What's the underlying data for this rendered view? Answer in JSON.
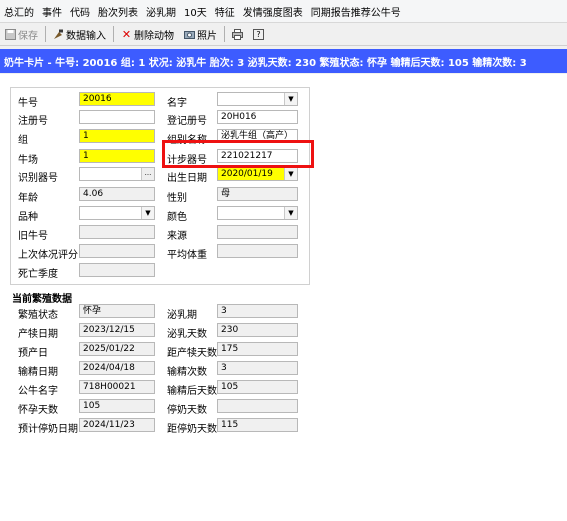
{
  "menu": [
    "总汇的",
    "事件",
    "代码",
    "胎次列表",
    "泌乳期",
    "10天",
    "特征",
    "发情强度图表",
    "同期报告推荐公牛号"
  ],
  "toolbar": {
    "save": "保存",
    "data_input": "数据输入",
    "delete_animal": "删除动物",
    "photo": "照片"
  },
  "title": "奶牛卡片 - 牛号: 20016  组: 1  状况: 泌乳牛  胎次: 3  泌乳天数: 230  繁殖状态: 怀孕  输精后天数: 105  输精次数: 3",
  "basic": {
    "cow_no_label": "牛号",
    "cow_no": "20016",
    "name_label": "名字",
    "name": "",
    "reg_no_label": "注册号",
    "reg_no": "",
    "herdbook_label": "登记册号",
    "herdbook": "20H016",
    "group_label": "组",
    "group": "1",
    "group_name_label": "组别名称",
    "group_name": "泌乳牛组（高产）",
    "farm_label": "牛场",
    "farm": "1",
    "pedometer_label": "计步器号",
    "pedometer": "221021217",
    "id_label": "识别器号",
    "id": "",
    "birth_label": "出生日期",
    "birth": "2020/01/19",
    "age_label": "年龄",
    "age": "4.06",
    "sex_label": "性别",
    "sex": "母",
    "breed_label": "品种",
    "breed": "",
    "color_label": "颜色",
    "color": "",
    "old_no_label": "旧牛号",
    "old_no": "",
    "source_label": "来源",
    "source": "",
    "bcs_label": "上次体况评分",
    "bcs": "",
    "avg_weight_label": "平均体重",
    "avg_weight": "",
    "death_season_label": "死亡季度",
    "death_season": ""
  },
  "repro": {
    "section_title": "当前繁殖数据",
    "status_label": "繁殖状态",
    "status": "怀孕",
    "lact_label": "泌乳期",
    "lact": "3",
    "calving_label": "产犊日期",
    "calving": "2023/12/15",
    "dim_label": "泌乳天数",
    "dim": "230",
    "due_label": "预产日",
    "due": "2025/01/22",
    "days_since_calving_label": "距产犊天数",
    "days_since_calving": "175",
    "ins_date_label": "输精日期",
    "ins_date": "2024/04/18",
    "ins_count_label": "输精次数",
    "ins_count": "3",
    "sire_label": "公牛名字",
    "sire": "718H00021",
    "dsi_label": "输精后天数",
    "dsi": "105",
    "preg_days_label": "怀孕天数",
    "preg_days": "105",
    "dry_days_label": "停奶天数",
    "dry_days": "",
    "exp_dry_label": "预计停奶日期",
    "exp_dry": "2024/11/23",
    "to_dry_label": "距停奶天数",
    "to_dry": "115"
  }
}
